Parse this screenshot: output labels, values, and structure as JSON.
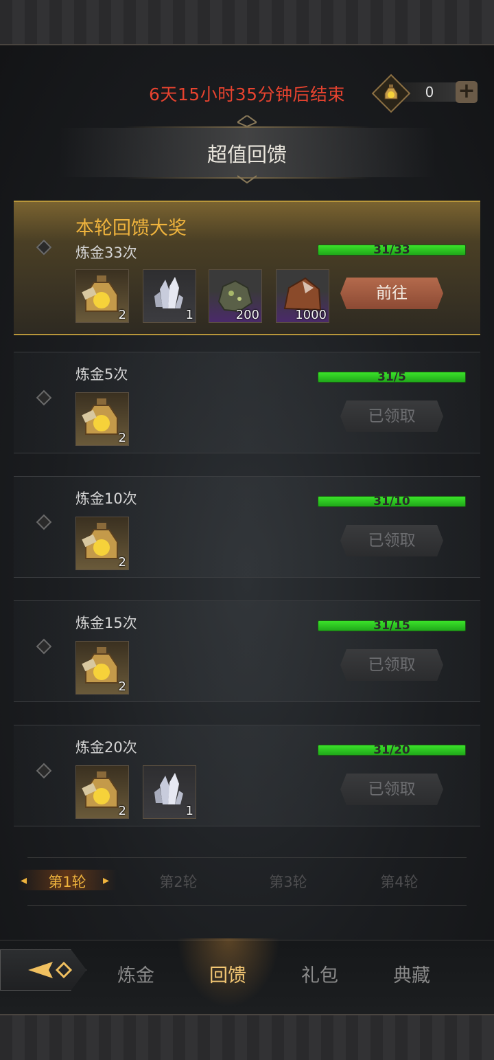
{
  "header": {
    "timer": "6天15小时35分钟后结束",
    "currency_count": "0",
    "currency_icon": "potion-icon",
    "add_icon": "plus-icon"
  },
  "title": "超值回馈",
  "grand_prize": {
    "title": "本轮回馈大奖",
    "label": "炼金33次",
    "progress_text": "31/33",
    "progress": 0.94,
    "items": [
      {
        "icon": "potion-icon",
        "qty": "2"
      },
      {
        "icon": "crystal-icon",
        "qty": "1"
      },
      {
        "icon": "green-ore-icon",
        "qty": "200"
      },
      {
        "icon": "copper-ore-icon",
        "qty": "1000"
      }
    ],
    "button": "前往"
  },
  "tiers": [
    {
      "label": "炼金5次",
      "progress_text": "31/5",
      "progress": 1.0,
      "items": [
        {
          "icon": "potion-icon",
          "qty": "2"
        }
      ],
      "button": "已领取"
    },
    {
      "label": "炼金10次",
      "progress_text": "31/10",
      "progress": 1.0,
      "items": [
        {
          "icon": "potion-icon",
          "qty": "2"
        }
      ],
      "button": "已领取"
    },
    {
      "label": "炼金15次",
      "progress_text": "31/15",
      "progress": 1.0,
      "items": [
        {
          "icon": "potion-icon",
          "qty": "2"
        }
      ],
      "button": "已领取"
    },
    {
      "label": "炼金20次",
      "progress_text": "31/20",
      "progress": 1.0,
      "items": [
        {
          "icon": "potion-icon",
          "qty": "2"
        },
        {
          "icon": "crystal-icon",
          "qty": "1"
        }
      ],
      "button": "已领取"
    }
  ],
  "rounds": [
    "第1轮",
    "第2轮",
    "第3轮",
    "第4轮"
  ],
  "active_round": 0,
  "nav": [
    "炼金",
    "回馈",
    "礼包",
    "典藏"
  ],
  "active_nav": 1,
  "colors": {
    "accent_gold": "#f0b43d",
    "timer_red": "#e8432f",
    "progress_green": "#3be22a",
    "go_button": "#b46a4c"
  }
}
